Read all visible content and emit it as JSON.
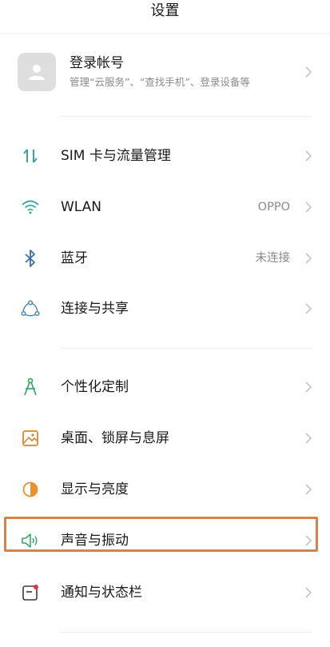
{
  "header": {
    "title": "设置"
  },
  "account": {
    "title": "登录帐号",
    "subtitle": "管理“云服务”、“查找手机”、登录设备等",
    "icon": "person-avatar-icon"
  },
  "items": [
    {
      "label": "SIM 卡与流量管理",
      "value": "",
      "icon": "sim-data-icon",
      "icon_color": "#3aa6a0"
    },
    {
      "label": "WLAN",
      "value": "OPPO",
      "icon": "wifi-icon",
      "icon_color": "#3aa6a0"
    },
    {
      "label": "蓝牙",
      "value": "未连接",
      "icon": "bluetooth-icon",
      "icon_color": "#3a6ea8"
    },
    {
      "label": "连接与共享",
      "value": "",
      "icon": "share-connect-icon",
      "icon_color": "#4a86c5"
    },
    {
      "label": "个性化定制",
      "value": "",
      "icon": "personalize-icon",
      "icon_color": "#3aa66a"
    },
    {
      "label": "桌面、锁屏与息屏",
      "value": "",
      "icon": "wallpaper-icon",
      "icon_color": "#d8862e"
    },
    {
      "label": "显示与亮度",
      "value": "",
      "icon": "brightness-icon",
      "icon_color": "#e8912e"
    },
    {
      "label": "声音与振动",
      "value": "",
      "icon": "sound-icon",
      "icon_color": "#3aa66a"
    },
    {
      "label": "通知与状态栏",
      "value": "",
      "icon": "notification-icon",
      "icon_color": "#e0334a"
    }
  ],
  "colors": {
    "highlight": "#d9814b",
    "chevron": "#c4c4c4",
    "secondary_text": "#8a8a8a"
  }
}
